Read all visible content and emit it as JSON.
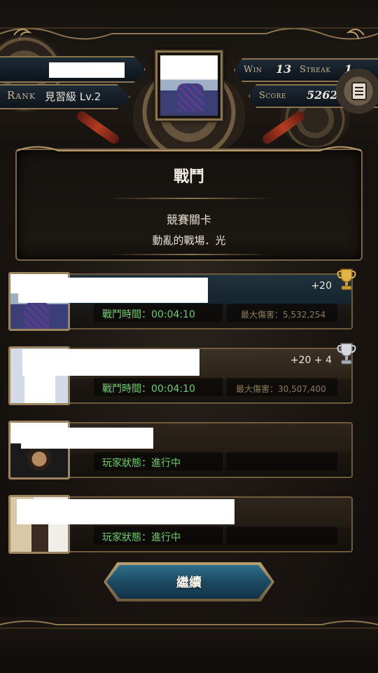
{
  "header": {
    "rank_label": "Rank",
    "rank_value": "見習級 Lv.2",
    "win_label": "Win",
    "win_value": "13",
    "streak_label": "Streak",
    "streak_value": "1",
    "score_label": "Score",
    "score_value": "5262",
    "menu_icon": "menu-list-icon"
  },
  "panel": {
    "title": "戰鬥",
    "subtitle": "競賽關卡",
    "stage": "動亂的戰場．光"
  },
  "players": [
    {
      "bonus": "+20",
      "trophy": "gold-trophy-icon",
      "status": "戰鬥時間：00:04:10",
      "extra": "最大傷害：5,532,254"
    },
    {
      "bonus": "+20 + 4",
      "trophy": "silver-trophy-icon",
      "status": "戰鬥時間：00:04:10",
      "extra": "最大傷害：30,507,400"
    },
    {
      "bonus": "",
      "trophy": "",
      "status": "玩家狀態：進行中",
      "extra": ""
    },
    {
      "bonus": "",
      "trophy": "",
      "status": "玩家狀態：進行中",
      "extra": ""
    }
  ],
  "actions": {
    "continue_label": "繼續"
  },
  "colors": {
    "accent_gold": "#8c7550",
    "status_green": "#6fd06a",
    "button_blue": "#1c4a62"
  }
}
